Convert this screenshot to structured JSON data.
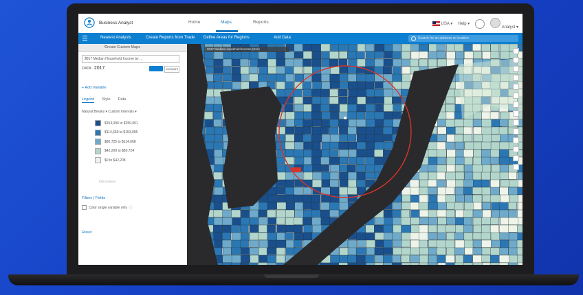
{
  "app": {
    "brand_name": "Business Analyst",
    "nav": [
      {
        "label": "Home",
        "active": false
      },
      {
        "label": "Maps",
        "active": true
      },
      {
        "label": "Reports",
        "active": false
      }
    ],
    "country": "USA",
    "help_label": "Help",
    "user_label": "Analyst"
  },
  "toolbar": {
    "items": [
      "Nearest Analysis",
      "Create Reports from Trade",
      "Define Areas for Regions",
      "Add Data"
    ],
    "search_placeholder": "Search for an address or location"
  },
  "panel": {
    "header": "Create Custom Maps",
    "variable": "2017 Median Household Income by ...",
    "year_label": "DATA",
    "year_value": "2017",
    "year_button2": "Compare",
    "add_variable": "+ Add Variable",
    "tabs": [
      {
        "label": "Legend",
        "active": true
      },
      {
        "label": "Style",
        "active": false
      },
      {
        "label": "Data",
        "active": false
      }
    ],
    "classification": "Natural Breaks  ▾    Custom Intervals  ▾",
    "legend": [
      {
        "label": "$153,096  to  $250,001",
        "color": "#1a4f8c"
      },
      {
        "label": "$114,669  to  $153,095",
        "color": "#2b77b4"
      },
      {
        "label": "$80,725   to  $114,668",
        "color": "#6faacb"
      },
      {
        "label": "$42,209   to  $80,724",
        "color": "#b3d6cc"
      },
      {
        "label": "$0        to  $42,208",
        "color": "#eef4e9"
      }
    ],
    "legend_note": "Edit classes",
    "filter_links": "Filters  |  Fields",
    "checkbox_label": "Color single variable only",
    "reset_label": "Reset"
  },
  "map": {
    "title": "2017 Median Household Income (Esri)",
    "accent_color": "#d9342b",
    "water_color": "#2a2a2c",
    "tool_icons": [
      "zoom-in-icon",
      "zoom-out-icon",
      "home-icon",
      "layers-icon",
      "basemap-icon",
      "measure-icon",
      "select-icon",
      "print-icon",
      "share-icon",
      "legend-icon",
      "table-icon",
      "settings-icon",
      "info-icon",
      "help-icon"
    ]
  }
}
